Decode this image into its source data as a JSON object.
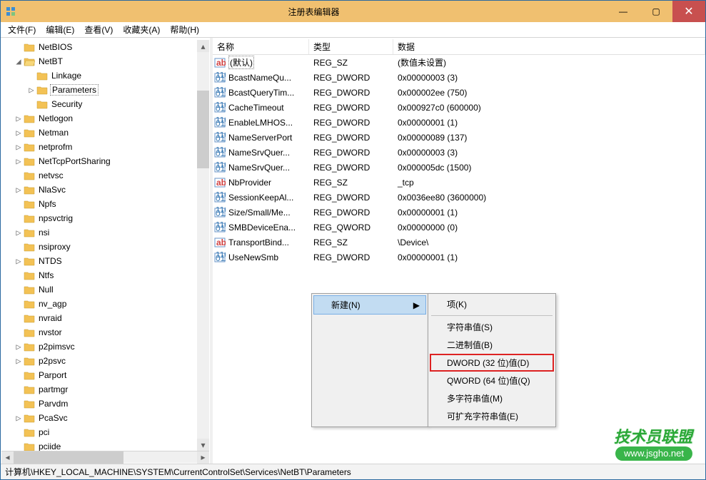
{
  "window": {
    "title": "注册表编辑器"
  },
  "menu": {
    "file": "文件(F)",
    "edit": "编辑(E)",
    "view": "查看(V)",
    "fav": "收藏夹(A)",
    "help": "帮助(H)"
  },
  "tree": [
    {
      "indent": 108,
      "tw": "",
      "label": "NetBIOS"
    },
    {
      "indent": 108,
      "tw": "◢",
      "label": "NetBT",
      "open": true
    },
    {
      "indent": 126,
      "tw": "",
      "label": "Linkage"
    },
    {
      "indent": 126,
      "tw": "▷",
      "label": "Parameters",
      "sel": true
    },
    {
      "indent": 126,
      "tw": "",
      "label": "Security"
    },
    {
      "indent": 108,
      "tw": "▷",
      "label": "Netlogon"
    },
    {
      "indent": 108,
      "tw": "▷",
      "label": "Netman"
    },
    {
      "indent": 108,
      "tw": "▷",
      "label": "netprofm"
    },
    {
      "indent": 108,
      "tw": "▷",
      "label": "NetTcpPortSharing"
    },
    {
      "indent": 108,
      "tw": "",
      "label": "netvsc"
    },
    {
      "indent": 108,
      "tw": "▷",
      "label": "NlaSvc"
    },
    {
      "indent": 108,
      "tw": "",
      "label": "Npfs"
    },
    {
      "indent": 108,
      "tw": "",
      "label": "npsvctrig"
    },
    {
      "indent": 108,
      "tw": "▷",
      "label": "nsi"
    },
    {
      "indent": 108,
      "tw": "",
      "label": "nsiproxy"
    },
    {
      "indent": 108,
      "tw": "▷",
      "label": "NTDS"
    },
    {
      "indent": 108,
      "tw": "",
      "label": "Ntfs"
    },
    {
      "indent": 108,
      "tw": "",
      "label": "Null"
    },
    {
      "indent": 108,
      "tw": "",
      "label": "nv_agp"
    },
    {
      "indent": 108,
      "tw": "",
      "label": "nvraid"
    },
    {
      "indent": 108,
      "tw": "",
      "label": "nvstor"
    },
    {
      "indent": 108,
      "tw": "▷",
      "label": "p2pimsvc"
    },
    {
      "indent": 108,
      "tw": "▷",
      "label": "p2psvc"
    },
    {
      "indent": 108,
      "tw": "",
      "label": "Parport"
    },
    {
      "indent": 108,
      "tw": "",
      "label": "partmgr"
    },
    {
      "indent": 108,
      "tw": "",
      "label": "Parvdm"
    },
    {
      "indent": 108,
      "tw": "▷",
      "label": "PcaSvc"
    },
    {
      "indent": 108,
      "tw": "",
      "label": "pci"
    },
    {
      "indent": 108,
      "tw": "",
      "label": "pciide"
    }
  ],
  "columns": {
    "name": "名称",
    "type": "类型",
    "data": "数据"
  },
  "values": [
    {
      "kind": "sz",
      "name": "(默认)",
      "type": "REG_SZ",
      "data": "(数值未设置)",
      "def": true
    },
    {
      "kind": "dw",
      "name": "BcastNameQu...",
      "type": "REG_DWORD",
      "data": "0x00000003 (3)"
    },
    {
      "kind": "dw",
      "name": "BcastQueryTim...",
      "type": "REG_DWORD",
      "data": "0x000002ee (750)"
    },
    {
      "kind": "dw",
      "name": "CacheTimeout",
      "type": "REG_DWORD",
      "data": "0x000927c0 (600000)"
    },
    {
      "kind": "dw",
      "name": "EnableLMHOS...",
      "type": "REG_DWORD",
      "data": "0x00000001 (1)"
    },
    {
      "kind": "dw",
      "name": "NameServerPort",
      "type": "REG_DWORD",
      "data": "0x00000089 (137)"
    },
    {
      "kind": "dw",
      "name": "NameSrvQuer...",
      "type": "REG_DWORD",
      "data": "0x00000003 (3)"
    },
    {
      "kind": "dw",
      "name": "NameSrvQuer...",
      "type": "REG_DWORD",
      "data": "0x000005dc (1500)"
    },
    {
      "kind": "sz",
      "name": "NbProvider",
      "type": "REG_SZ",
      "data": "_tcp"
    },
    {
      "kind": "dw",
      "name": "SessionKeepAl...",
      "type": "REG_DWORD",
      "data": "0x0036ee80 (3600000)"
    },
    {
      "kind": "dw",
      "name": "Size/Small/Me...",
      "type": "REG_DWORD",
      "data": "0x00000001 (1)"
    },
    {
      "kind": "dw",
      "name": "SMBDeviceEna...",
      "type": "REG_QWORD",
      "data": "0x00000000 (0)"
    },
    {
      "kind": "sz",
      "name": "TransportBind...",
      "type": "REG_SZ",
      "data": "\\Device\\"
    },
    {
      "kind": "dw",
      "name": "UseNewSmb",
      "type": "REG_DWORD",
      "data": "0x00000001 (1)"
    }
  ],
  "context": {
    "new": "新建(N)",
    "arrow": "▶",
    "items": {
      "key": "项(K)",
      "string": "字符串值(S)",
      "binary": "二进制值(B)",
      "dword": "DWORD (32 位)值(D)",
      "qword": "QWORD (64 位)值(Q)",
      "multi": "多字符串值(M)",
      "expand": "可扩充字符串值(E)"
    }
  },
  "status": "计算机\\HKEY_LOCAL_MACHINE\\SYSTEM\\CurrentControlSet\\Services\\NetBT\\Parameters",
  "watermark": {
    "line1": "技术员联盟",
    "line2": "www.jsgho.net"
  }
}
